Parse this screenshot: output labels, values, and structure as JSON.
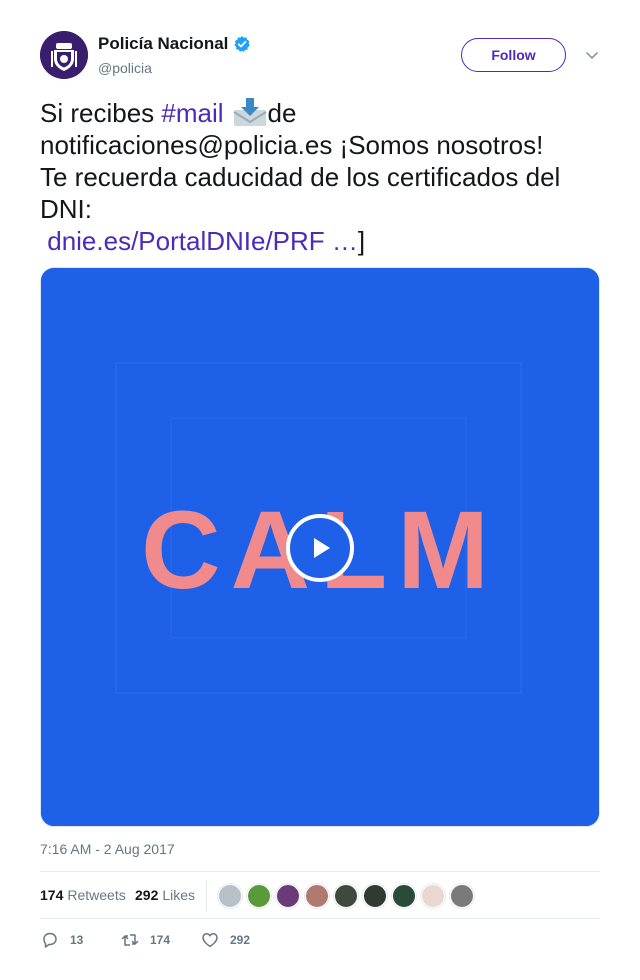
{
  "account": {
    "display_name": "Policía Nacional",
    "handle": "@policia",
    "verified_icon": "verified-badge-icon",
    "follow_label": "Follow"
  },
  "tweet": {
    "line1_pre": "Si recibes ",
    "hashtag": "#mail",
    "line1_post": "de",
    "line2": "notificaciones@policia.es ¡Somos nosotros!",
    "line3": "Te recuerda caducidad de los certificados del",
    "line4": "DNI:",
    "link": "dnie.es/PortalDNIe/PRF",
    "link_ellipsis": " …",
    "closing_bracket": "]"
  },
  "media": {
    "video_word": "CALM",
    "background_color": "#1f60e8",
    "letter_color": "#f08a8c"
  },
  "timestamp": "7:16 AM - 2 Aug 2017",
  "stats": {
    "retweets_count": "174",
    "retweets_label": "Retweets",
    "likes_count": "292",
    "likes_label": "Likes"
  },
  "actions": {
    "reply_count": "13",
    "retweet_count": "174",
    "like_count": "292"
  },
  "colors": {
    "accent": "#4b2bb7",
    "verified": "#1da1f2",
    "muted": "#657786"
  }
}
